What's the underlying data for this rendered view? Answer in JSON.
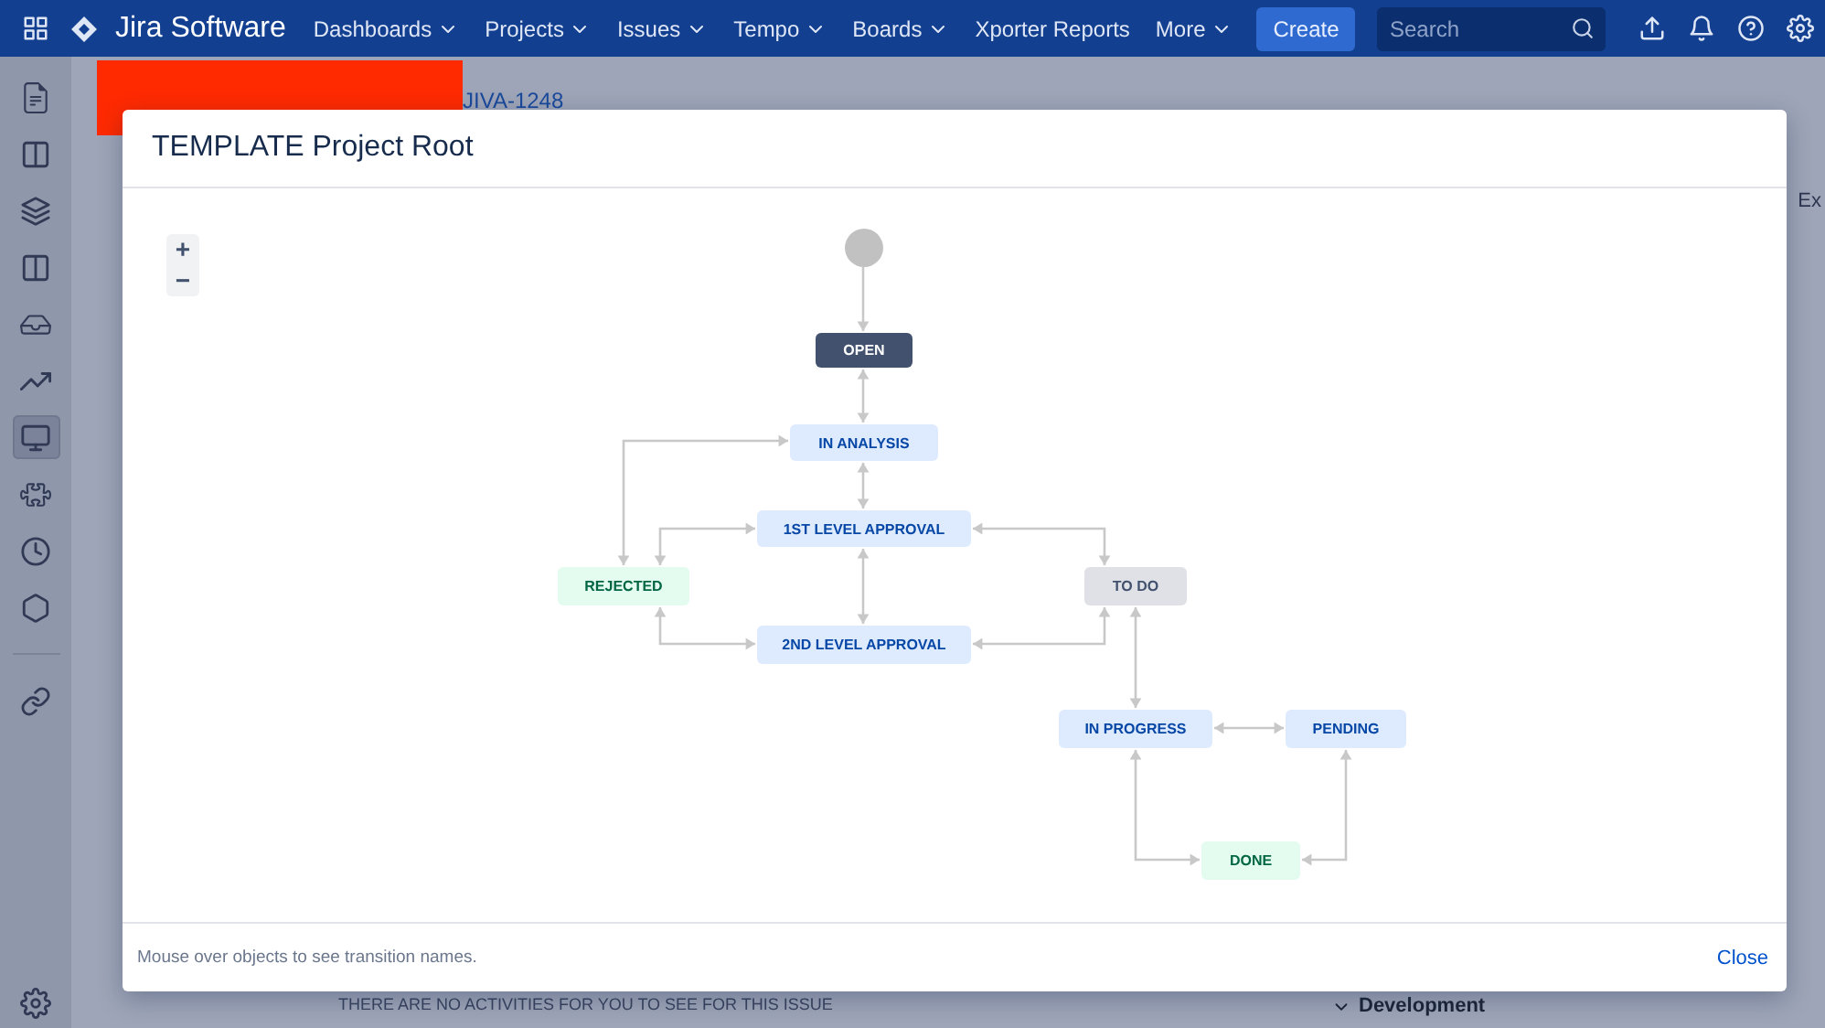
{
  "nav": {
    "product": "Jira Software",
    "menus": [
      {
        "label": "Dashboards",
        "dropdown": true
      },
      {
        "label": "Projects",
        "dropdown": true
      },
      {
        "label": "Issues",
        "dropdown": true
      },
      {
        "label": "Tempo",
        "dropdown": true
      },
      {
        "label": "Boards",
        "dropdown": true
      },
      {
        "label": "Xporter Reports",
        "dropdown": false
      },
      {
        "label": "More",
        "dropdown": true
      }
    ],
    "create": "Create",
    "search": {
      "placeholder": "Search"
    }
  },
  "sidebar": {
    "items": [
      {
        "selected": false
      },
      {
        "selected": false
      },
      {
        "selected": false
      },
      {
        "selected": false
      },
      {
        "selected": false
      },
      {
        "selected": false
      },
      {
        "selected": true
      },
      {
        "selected": false
      },
      {
        "selected": false
      },
      {
        "selected": false
      },
      {
        "selected": false
      }
    ]
  },
  "issue": {
    "key": "JIVA-1248",
    "export_button": "Ex",
    "development_heading": "Development",
    "activity_message": "THERE ARE NO ACTIVITIES FOR YOU TO SEE FOR THIS ISSUE"
  },
  "modal": {
    "title": "TEMPLATE Project Root",
    "zoom_in": "+",
    "zoom_out": "−",
    "nodes": [
      {
        "kind": "start"
      },
      {
        "label": "OPEN",
        "kind": "dark"
      },
      {
        "label": "IN ANALYSIS",
        "kind": "blue"
      },
      {
        "label": "1ST LEVEL APPROVAL",
        "kind": "blue"
      },
      {
        "label": "REJECTED",
        "kind": "green"
      },
      {
        "label": "TO DO",
        "kind": "grey"
      },
      {
        "label": "2ND LEVEL APPROVAL",
        "kind": "blue"
      },
      {
        "label": "IN PROGRESS",
        "kind": "blue"
      },
      {
        "label": "PENDING",
        "kind": "blue"
      },
      {
        "label": "DONE",
        "kind": "green"
      }
    ],
    "hint": "Mouse over objects to see transition names.",
    "close": "Close"
  }
}
